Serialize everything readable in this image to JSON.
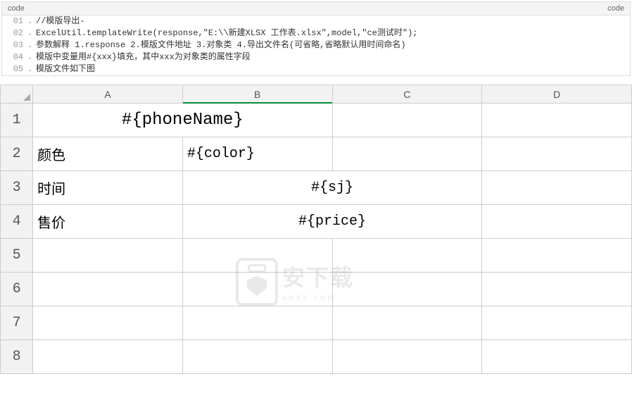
{
  "code_block": {
    "header_left": "code",
    "header_right": "code",
    "lines": [
      {
        "n": "01",
        "t": "//模版导出-"
      },
      {
        "n": "02",
        "t": "ExcelUtil.templateWrite(response,\"E:\\\\新建XLSX 工作表.xlsx\",model,\"ce测试时\");"
      },
      {
        "n": "03",
        "t": "参数解释 1.response 2.模版文件地址 3.对象类 4.导出文件名(可省略,省略默认用时间命名)"
      },
      {
        "n": "04",
        "t": "模版中变量用#{xxx}填充，其中xxx为对象类的属性字段"
      },
      {
        "n": "05",
        "t": "模版文件如下图"
      }
    ]
  },
  "spreadsheet": {
    "columns": [
      "A",
      "B",
      "C",
      "D"
    ],
    "active_column": "B",
    "rows": [
      "1",
      "2",
      "3",
      "4",
      "5",
      "6",
      "7",
      "8"
    ],
    "cells": {
      "r1_merged": "#{phoneName}",
      "r2_a": "颜色",
      "r2_b": "#{color}",
      "r3_a": "时间",
      "r3_bc": "#{sj}",
      "r4_a": "售价",
      "r4_bc": "#{price}"
    }
  },
  "watermark": {
    "cn": "安下载",
    "en": "anxz.com"
  }
}
